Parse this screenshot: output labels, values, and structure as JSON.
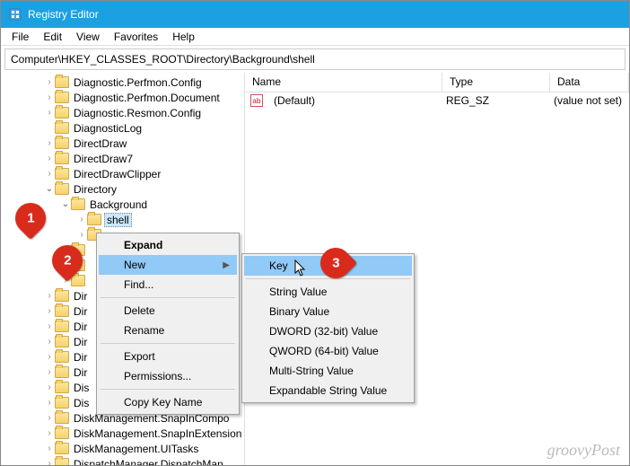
{
  "window": {
    "title": "Registry Editor"
  },
  "menubar": {
    "file": "File",
    "edit": "Edit",
    "view": "View",
    "favorites": "Favorites",
    "help": "Help"
  },
  "address": "Computer\\HKEY_CLASSES_ROOT\\Directory\\Background\\shell",
  "tree": {
    "items": [
      {
        "indent": 48,
        "chev": "›",
        "label": "Diagnostic.Perfmon.Config"
      },
      {
        "indent": 48,
        "chev": "›",
        "label": "Diagnostic.Perfmon.Document"
      },
      {
        "indent": 48,
        "chev": "›",
        "label": "Diagnostic.Resmon.Config"
      },
      {
        "indent": 48,
        "chev": "",
        "label": "DiagnosticLog"
      },
      {
        "indent": 48,
        "chev": "›",
        "label": "DirectDraw"
      },
      {
        "indent": 48,
        "chev": "›",
        "label": "DirectDraw7"
      },
      {
        "indent": 48,
        "chev": "›",
        "label": "DirectDrawClipper"
      },
      {
        "indent": 48,
        "chev": "v",
        "label": "Directory"
      },
      {
        "indent": 66,
        "chev": "v",
        "label": "Background"
      },
      {
        "indent": 84,
        "chev": "›",
        "label": "shell",
        "selected": true
      },
      {
        "indent": 84,
        "chev": "›",
        "label": ""
      },
      {
        "indent": 66,
        "chev": "›",
        "label": ""
      },
      {
        "indent": 66,
        "chev": "›",
        "label": ""
      },
      {
        "indent": 66,
        "chev": "›",
        "label": ""
      },
      {
        "indent": 48,
        "chev": "›",
        "label": "Dir"
      },
      {
        "indent": 48,
        "chev": "›",
        "label": "Dir"
      },
      {
        "indent": 48,
        "chev": "›",
        "label": "Dir"
      },
      {
        "indent": 48,
        "chev": "›",
        "label": "Dir"
      },
      {
        "indent": 48,
        "chev": "›",
        "label": "Dir"
      },
      {
        "indent": 48,
        "chev": "›",
        "label": "Dir"
      },
      {
        "indent": 48,
        "chev": "›",
        "label": "Dis"
      },
      {
        "indent": 48,
        "chev": "›",
        "label": "Dis"
      },
      {
        "indent": 48,
        "chev": "›",
        "label": "DiskManagement.SnapInCompo"
      },
      {
        "indent": 48,
        "chev": "›",
        "label": "DiskManagement.SnapInExtension"
      },
      {
        "indent": 48,
        "chev": "›",
        "label": "DiskManagement.UITasks"
      },
      {
        "indent": 48,
        "chev": "›",
        "label": "DispatchManager.DispatchMan"
      }
    ]
  },
  "listview": {
    "headers": {
      "name": "Name",
      "type": "Type",
      "data": "Data"
    },
    "row": {
      "name": "(Default)",
      "type": "REG_SZ",
      "data": "(value not set)"
    }
  },
  "context_menu_1": {
    "expand": "Expand",
    "new": "New",
    "find": "Find...",
    "delete": "Delete",
    "rename": "Rename",
    "export": "Export",
    "permissions": "Permissions...",
    "copy_key_name": "Copy Key Name"
  },
  "context_menu_2": {
    "key": "Key",
    "string": "String Value",
    "binary": "Binary Value",
    "dword": "DWORD (32-bit) Value",
    "qword": "QWORD (64-bit) Value",
    "multi": "Multi-String Value",
    "expand": "Expandable String Value"
  },
  "badges": {
    "b1": "1",
    "b2": "2",
    "b3": "3"
  },
  "watermark": "groovyPost",
  "icon_text": "ab"
}
